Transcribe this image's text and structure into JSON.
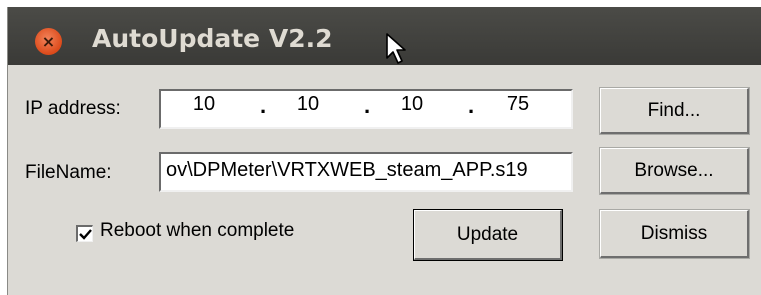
{
  "window": {
    "title": "AutoUpdate V2.2",
    "close_glyph": "×"
  },
  "form": {
    "ip_label": "IP address:",
    "ip_octets": [
      "10",
      "10",
      "10",
      "75"
    ],
    "filename_label": "FileName:",
    "filename_value": "ov\\DPMeter\\VRTXWEB_steam_APP.s19",
    "reboot_label": "Reboot when complete",
    "reboot_checked": true
  },
  "buttons": {
    "find": "Find...",
    "browse": "Browse...",
    "update": "Update",
    "dismiss": "Dismiss"
  },
  "icons": [
    "close-icon",
    "mouse-cursor-icon",
    "checkmark-icon"
  ]
}
